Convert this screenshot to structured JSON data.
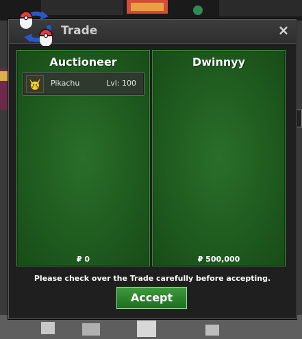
{
  "window": {
    "title": "Trade",
    "close_symbol": "×"
  },
  "left_panel": {
    "name": "Auctioneer",
    "items": [
      {
        "name": "Pikachu",
        "level": "Lvl: 100"
      }
    ],
    "money": "₽ 0"
  },
  "right_panel": {
    "name": "Dwinnyy",
    "items": [],
    "money": "₽ 500,000"
  },
  "notice": "Please check over the Trade carefully before accepting.",
  "accept_label": "Accept",
  "colors": {
    "panel_green": "#1e5a1e",
    "accept_green": "#2f8a2f"
  }
}
